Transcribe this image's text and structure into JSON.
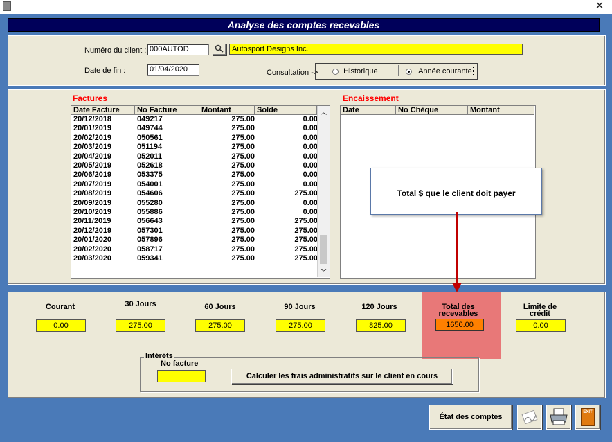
{
  "window": {
    "close_glyph": "✕"
  },
  "header": {
    "title": "Analyse des comptes recevables"
  },
  "client": {
    "number_label": "Numéro du client :",
    "number_value": "000AUTOD",
    "name_value": "Autosport Designs Inc.",
    "end_date_label": "Date de fin :",
    "end_date_value": "01/04/2020"
  },
  "consultation": {
    "label": "Consultation ->",
    "options": [
      "Historique",
      "Année courante"
    ],
    "selected": "Année courante"
  },
  "factures": {
    "title": "Factures",
    "columns": [
      "Date Facture",
      "No Facture",
      "Montant",
      "Solde"
    ],
    "rows": [
      [
        "20/12/2018",
        "049217",
        "275.00",
        "0.00"
      ],
      [
        "20/01/2019",
        "049744",
        "275.00",
        "0.00"
      ],
      [
        "20/02/2019",
        "050561",
        "275.00",
        "0.00"
      ],
      [
        "20/03/2019",
        "051194",
        "275.00",
        "0.00"
      ],
      [
        "20/04/2019",
        "052011",
        "275.00",
        "0.00"
      ],
      [
        "20/05/2019",
        "052618",
        "275.00",
        "0.00"
      ],
      [
        "20/06/2019",
        "053375",
        "275.00",
        "0.00"
      ],
      [
        "20/07/2019",
        "054001",
        "275.00",
        "0.00"
      ],
      [
        "20/08/2019",
        "054606",
        "275.00",
        "275.00"
      ],
      [
        "20/09/2019",
        "055280",
        "275.00",
        "0.00"
      ],
      [
        "20/10/2019",
        "055886",
        "275.00",
        "0.00"
      ],
      [
        "20/11/2019",
        "056643",
        "275.00",
        "275.00"
      ],
      [
        "20/12/2019",
        "057301",
        "275.00",
        "275.00"
      ],
      [
        "20/01/2020",
        "057896",
        "275.00",
        "275.00"
      ],
      [
        "20/02/2020",
        "058717",
        "275.00",
        "275.00"
      ],
      [
        "20/03/2020",
        "059341",
        "275.00",
        "275.00"
      ]
    ]
  },
  "encaissement": {
    "title": "Encaissement",
    "columns": [
      "Date",
      "No Chèque",
      "Montant"
    ]
  },
  "callout": {
    "text": "Total $ que le client doit payer"
  },
  "aging": {
    "courant": {
      "label": "Courant",
      "value": "0.00"
    },
    "j30": {
      "label": "30 Jours",
      "value": "275.00"
    },
    "j60": {
      "label": "60 Jours",
      "value": "275.00"
    },
    "j90": {
      "label": "90 Jours",
      "value": "275.00"
    },
    "j120": {
      "label": "120 Jours",
      "value": "825.00"
    },
    "total": {
      "label1": "Total des",
      "label2": "recevables",
      "value": "1650.00"
    },
    "limite": {
      "label1": "Limite de",
      "label2": "crédit",
      "value": "0.00"
    }
  },
  "interets": {
    "group_label": "Intérêts",
    "no_facture_label": "No facture",
    "no_facture_value": "",
    "calc_button": "Calculer les frais administratifs sur le client en cours"
  },
  "footer": {
    "etat_button": "État des comptes",
    "exit_label": "EXIT"
  },
  "colors": {
    "header_bg": "#00005a",
    "highlight": "#e87878",
    "arrow": "#c00000",
    "total_box": "#ff8000",
    "field_yellow": "#ffff00"
  }
}
